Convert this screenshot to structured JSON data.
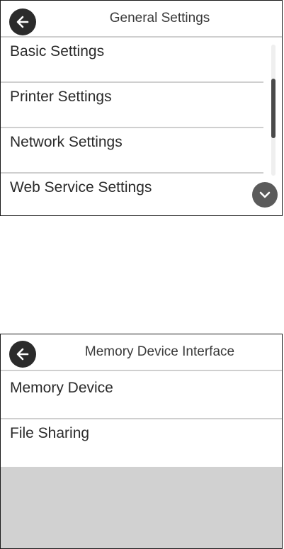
{
  "screen1": {
    "title": "General Settings",
    "items": [
      {
        "label": "Basic Settings"
      },
      {
        "label": "Printer Settings"
      },
      {
        "label": "Network Settings"
      },
      {
        "label": "Web Service Settings"
      }
    ],
    "icons": {
      "back": "arrow-left-icon",
      "scroll_down": "chevron-down-icon"
    }
  },
  "screen2": {
    "title": "Memory Device Interface",
    "items": [
      {
        "label": "Memory Device"
      },
      {
        "label": "File Sharing"
      }
    ],
    "icons": {
      "back": "arrow-left-icon"
    }
  }
}
